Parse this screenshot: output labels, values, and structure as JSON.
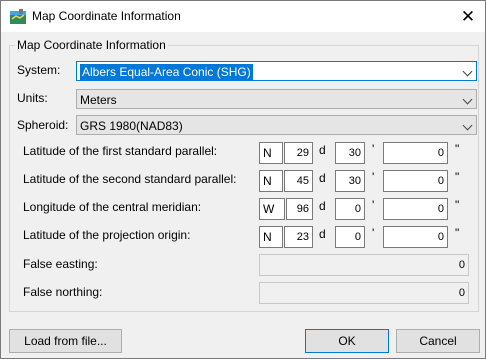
{
  "window": {
    "title": "Map Coordinate Information",
    "close_label": "✕"
  },
  "group": {
    "label": "Map Coordinate Information"
  },
  "system": {
    "label": "System:",
    "value": "Albers Equal-Area Conic (SHG)"
  },
  "units": {
    "label": "Units:",
    "value": "Meters"
  },
  "spheroid": {
    "label": "Spheroid:",
    "value": "GRS 1980(NAD83)"
  },
  "unit_marks": {
    "deg": "d",
    "min": "'",
    "sec": "\""
  },
  "params": [
    {
      "label": "Latitude of the first standard parallel:",
      "dir": "N",
      "deg": "29",
      "min": "30",
      "sec": "0"
    },
    {
      "label": "Latitude of the second standard parallel:",
      "dir": "N",
      "deg": "45",
      "min": "30",
      "sec": "0"
    },
    {
      "label": "Longitude of the central meridian:",
      "dir": "W",
      "deg": "96",
      "min": "0",
      "sec": "0"
    },
    {
      "label": "Latitude of the projection origin:",
      "dir": "N",
      "deg": "23",
      "min": "0",
      "sec": "0"
    }
  ],
  "false_easting": {
    "label": "False easting:",
    "value": "0"
  },
  "false_northing": {
    "label": "False northing:",
    "value": "0"
  },
  "buttons": {
    "load": "Load from file...",
    "ok": "OK",
    "cancel": "Cancel"
  }
}
